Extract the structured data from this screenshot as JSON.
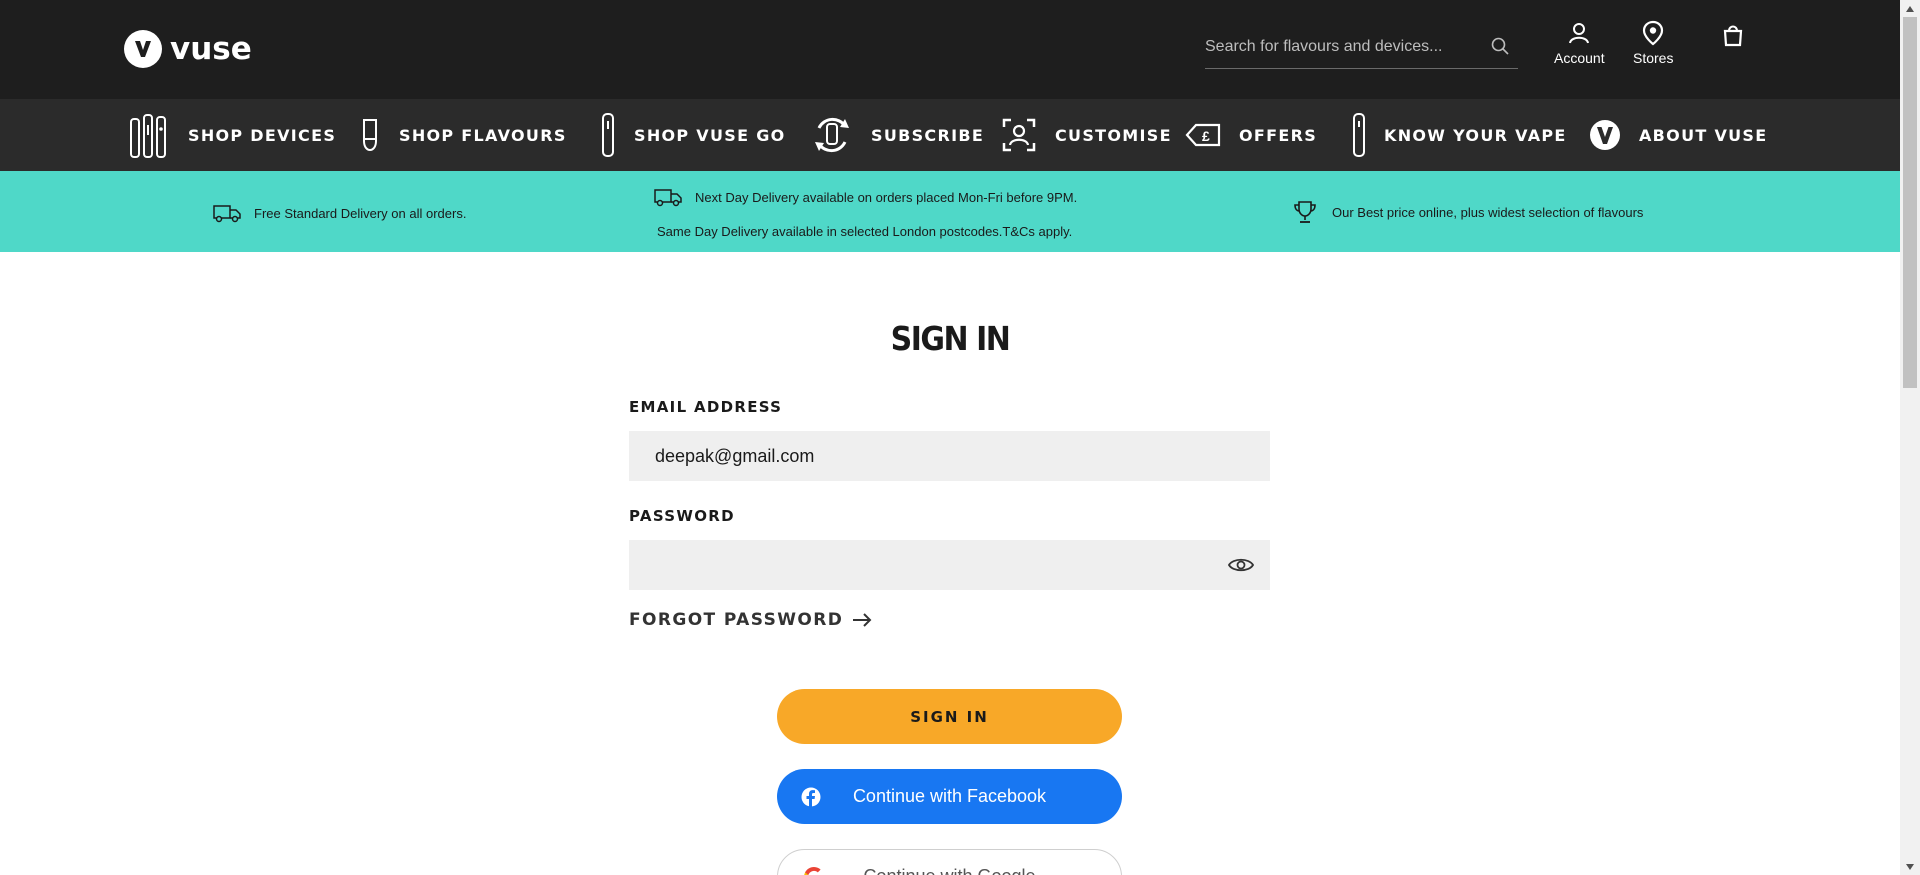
{
  "header": {
    "brand": "vuse",
    "search_placeholder": "Search for flavours and devices...",
    "account_label": "Account",
    "stores_label": "Stores"
  },
  "nav": {
    "items": [
      {
        "label": "SHOP DEVICES",
        "icon": "devices-icon"
      },
      {
        "label": "SHOP FLAVOURS",
        "icon": "pod-icon"
      },
      {
        "label": "SHOP VUSE GO",
        "icon": "disposable-icon"
      },
      {
        "label": "SUBSCRIBE",
        "icon": "subscribe-icon"
      },
      {
        "label": "CUSTOMISE",
        "icon": "customise-icon"
      },
      {
        "label": "OFFERS",
        "icon": "price-tag-icon"
      },
      {
        "label": "KNOW YOUR VAPE",
        "icon": "vape-pen-icon"
      },
      {
        "label": "ABOUT VUSE",
        "icon": "vuse-logo-icon"
      }
    ]
  },
  "promo": {
    "free_delivery": "Free Standard Delivery on all orders.",
    "next_day": "Next Day Delivery available on orders placed Mon-Fri before 9PM.",
    "same_day": "Same Day Delivery available in selected London postcodes.T&Cs apply.",
    "best_price": "Our Best price online, plus widest selection of flavours"
  },
  "signin": {
    "title": "SIGN IN",
    "email_label": "EMAIL ADDRESS",
    "email_value": "deepak@gmail.com",
    "password_label": "PASSWORD",
    "password_value": "",
    "forgot_label": "FORGOT PASSWORD",
    "signin_button": "SIGN IN",
    "facebook_button": "Continue with Facebook",
    "google_button": "Continue with Google"
  },
  "colors": {
    "topbar": "#1e1e1e",
    "navbar": "#2b2b2b",
    "promo": "#4fd8c8",
    "signin_button": "#f8a828",
    "facebook_button": "#1877f2"
  }
}
